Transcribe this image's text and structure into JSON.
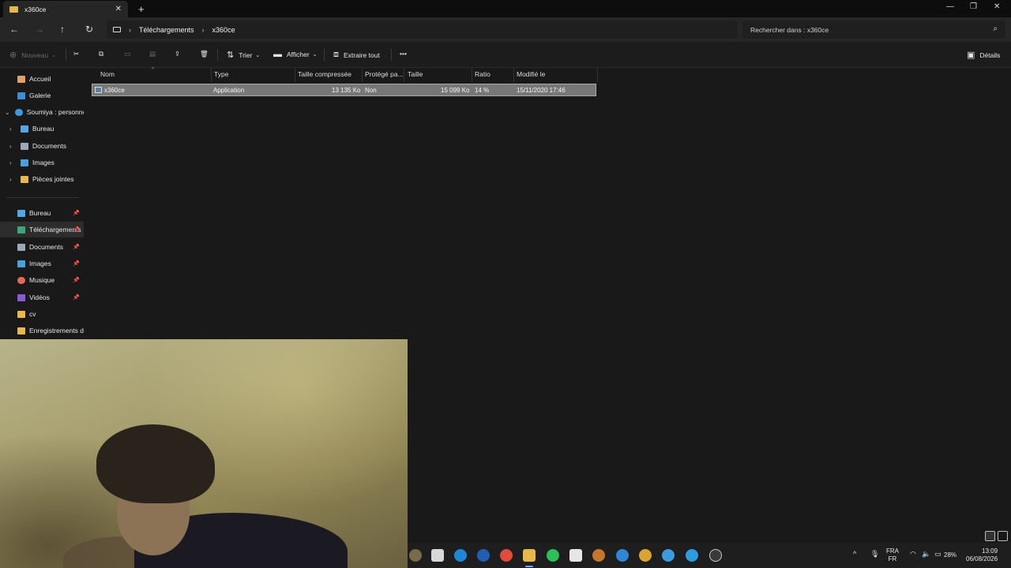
{
  "window": {
    "tab_title": "x360ce",
    "new_tab": "+",
    "close_tab": "✕",
    "minimize": "—",
    "maximize": "❐",
    "close": "✕"
  },
  "address": {
    "breadcrumbs": [
      "Téléchargements",
      "x360ce"
    ],
    "search_placeholder": "Rechercher dans : x360ce"
  },
  "commands": {
    "new": "Nouveau",
    "sort": "Trier",
    "view": "Afficher",
    "extract_all": "Extraire tout",
    "more": "•••",
    "details": "Détails"
  },
  "sidebar": {
    "items": [
      {
        "label": "Accueil",
        "icon": "home-icon",
        "color": "#e0a06a"
      },
      {
        "label": "Galerie",
        "icon": "gallery-icon",
        "color": "#3c8fd6"
      },
      {
        "label": "Soumiya : personne",
        "icon": "cloud-icon",
        "color": "#3a9be0",
        "expanded": true
      },
      {
        "label": "Bureau",
        "icon": "desktop-icon",
        "color": "#55a6e6"
      },
      {
        "label": "Documents",
        "icon": "documents-icon",
        "color": "#9aa8b8"
      },
      {
        "label": "Images",
        "icon": "images-icon",
        "color": "#4aa0dd"
      },
      {
        "label": "Pièces jointes",
        "icon": "folder-icon",
        "color": "#e8b94a"
      }
    ],
    "quick_access": [
      {
        "label": "Bureau",
        "icon": "desktop-icon",
        "color": "#55a6e6",
        "pinned": true
      },
      {
        "label": "Téléchargements",
        "icon": "download-icon",
        "color": "#3aa87a",
        "pinned": true,
        "active": true
      },
      {
        "label": "Documents",
        "icon": "documents-icon",
        "color": "#9aa8b8",
        "pinned": true
      },
      {
        "label": "Images",
        "icon": "images-icon",
        "color": "#4aa0dd",
        "pinned": true
      },
      {
        "label": "Musique",
        "icon": "music-icon",
        "color": "#e06a5a",
        "pinned": true
      },
      {
        "label": "Vidéos",
        "icon": "videos-icon",
        "color": "#8a5ad6",
        "pinned": true
      },
      {
        "label": "cv",
        "icon": "folder-icon",
        "color": "#e8b94a",
        "pinned": false
      },
      {
        "label": "Enregistrements d'é",
        "icon": "folder-icon",
        "color": "#e8b94a",
        "pinned": false
      }
    ]
  },
  "columns": [
    "Nom",
    "Type",
    "Taille compressée",
    "Protégé pa...",
    "Taille",
    "Ratio",
    "Modifié le"
  ],
  "files": [
    {
      "name": "x360ce",
      "type": "Application",
      "compressed": "13 135 Ko",
      "protected": "Non",
      "size": "15 099 Ko",
      "ratio": "14 %",
      "modified": "15/11/2020 17:46"
    }
  ],
  "tray": {
    "lang_top": "FRA",
    "lang_bottom": "FR",
    "battery": "28%",
    "time": "13:09",
    "date": "06/08/2026"
  }
}
